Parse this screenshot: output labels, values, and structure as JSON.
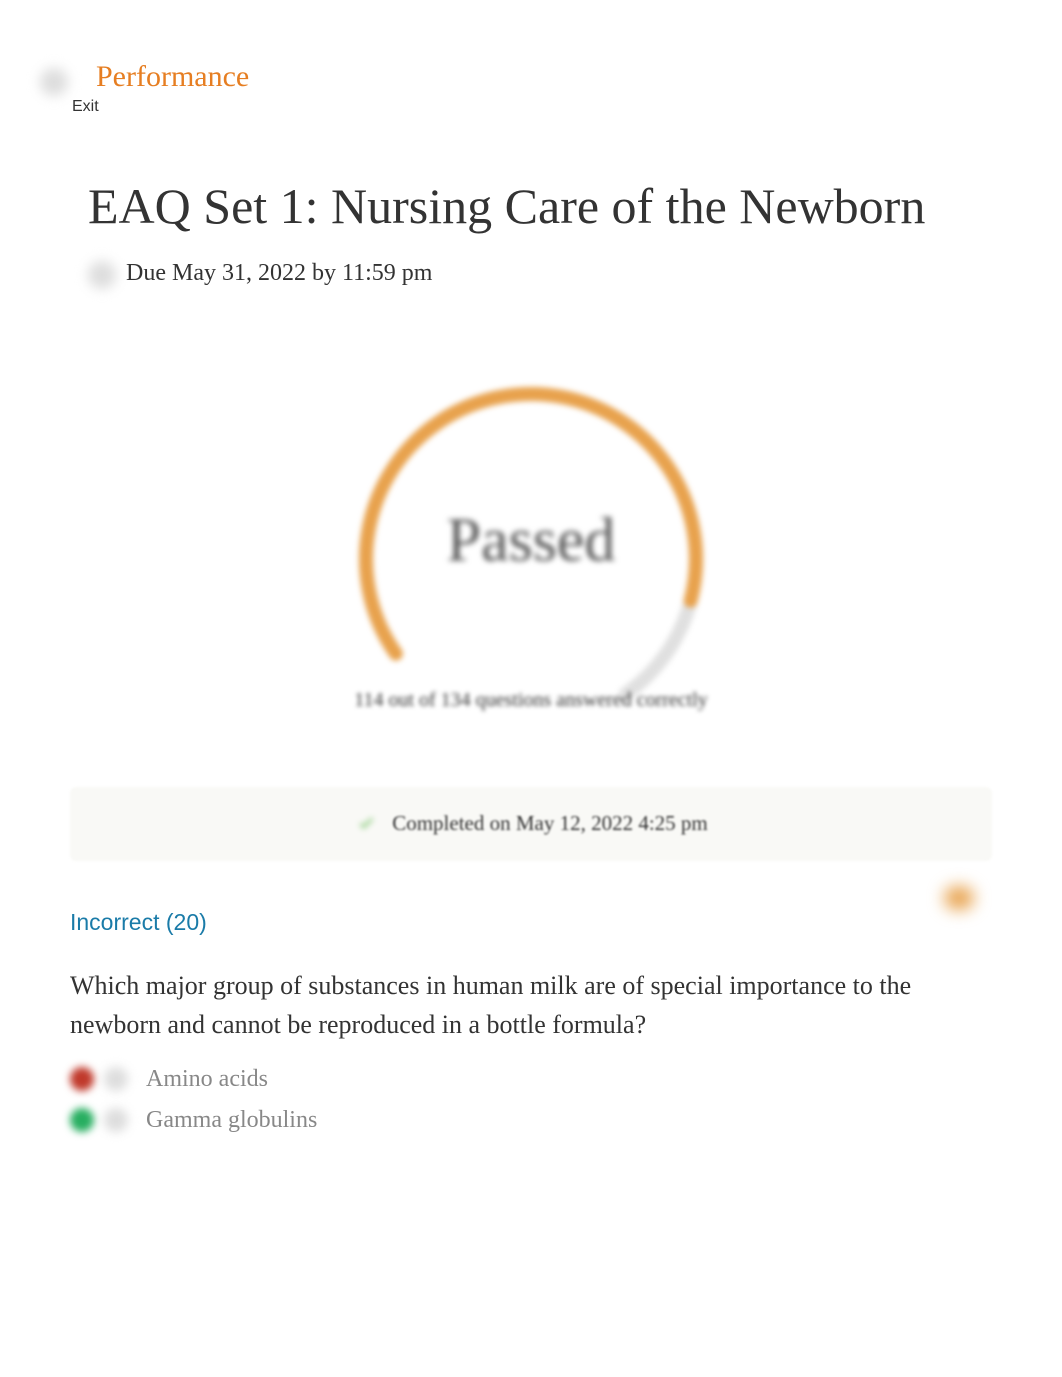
{
  "header": {
    "performance_label": "Performance",
    "exit_label": "Exit"
  },
  "page": {
    "title": "EAQ Set 1: Nursing Care of the Newborn",
    "due_text": "Due May 31, 2022 by 11:59 pm"
  },
  "progress": {
    "status_label": "Passed",
    "subtitle": "114 out of 134 questions answered correctly",
    "correct": 114,
    "total": 134
  },
  "completion": {
    "text": "Completed on May 12, 2022 4:25 pm"
  },
  "incorrect_section": {
    "heading": "Incorrect (20)",
    "count": 20
  },
  "question": {
    "text": "Which major group of substances in human milk are of special importance to the newborn and cannot be reproduced in a bottle formula?",
    "answers": [
      {
        "text": "Amino acids",
        "status": "incorrect"
      },
      {
        "text": "Gamma globulins",
        "status": "correct"
      }
    ]
  }
}
